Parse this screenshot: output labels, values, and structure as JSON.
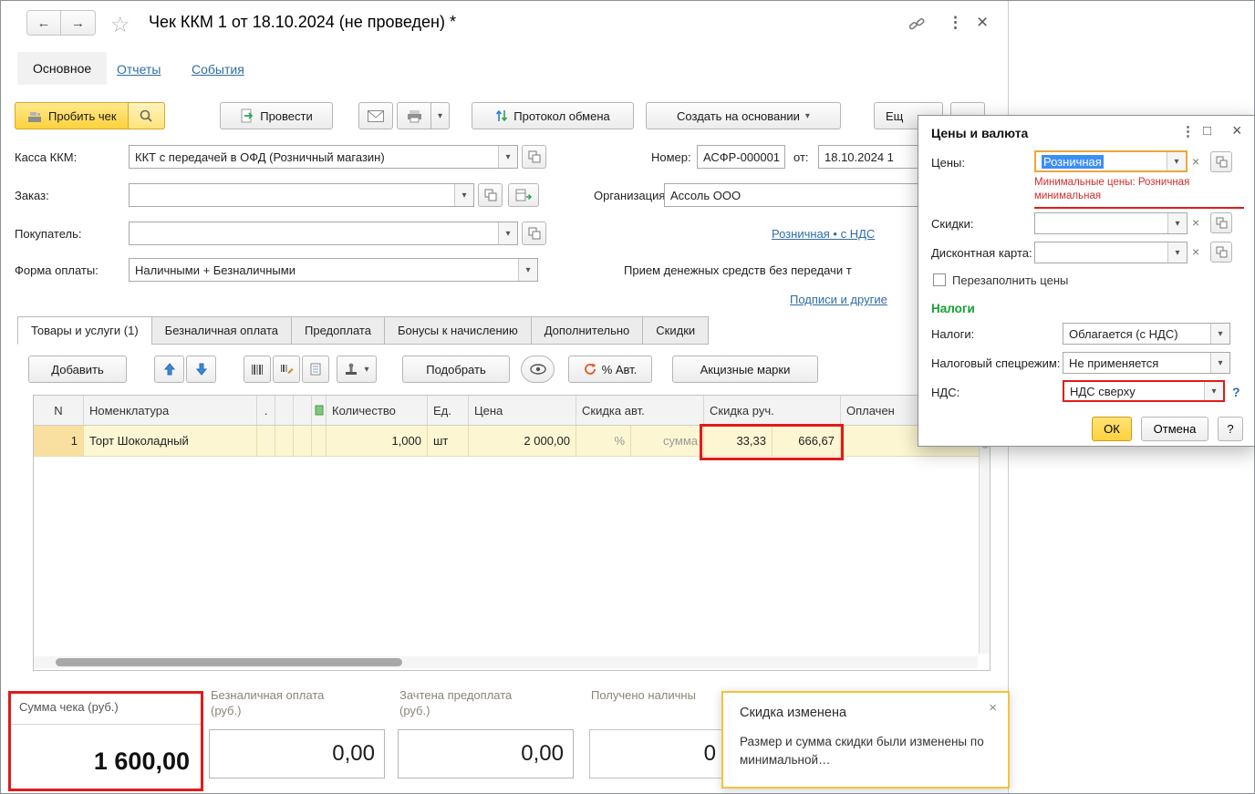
{
  "window": {
    "title": "Чек ККМ 1 от 18.10.2024 (не проведен) *",
    "nav": {
      "main": "Основное",
      "reports": "Отчеты",
      "events": "События"
    }
  },
  "icons": {
    "back": "←",
    "forward": "→",
    "star": "☆",
    "menu_dots": "⋮",
    "close": "×",
    "dropdown": "▾",
    "clear": "×",
    "maximize": "□",
    "question": "?"
  },
  "toolbar": {
    "punch_check": "Пробить чек",
    "post": "Провести",
    "protocol": "Протокол обмена",
    "create_based_on": "Создать на основании",
    "more": "Ещ"
  },
  "form": {
    "kassa": {
      "label": "Касса ККМ:",
      "value": "ККТ с передачей в ОФД (Розничный магазин)"
    },
    "order": {
      "label": "Заказ:",
      "value": ""
    },
    "customer": {
      "label": "Покупатель:",
      "value": ""
    },
    "payment": {
      "label": "Форма оплаты:",
      "value": "Наличными + Безналичными"
    },
    "number": {
      "label": "Номер:",
      "value": "АСФР-000001"
    },
    "date": {
      "label": "от:",
      "value": "18.10.2024 1"
    },
    "org": {
      "label": "Организация:",
      "value": "Ассоль ООО"
    },
    "price_type_link": "Розничная • с НДС",
    "note": "Прием денежных средств без передачи т",
    "signatures_link": "Подписи и другие"
  },
  "doc_tabs": [
    "Товары и услуги (1)",
    "Безналичная оплата",
    "Предоплата",
    "Бонусы к начислению",
    "Дополнительно",
    "Скидки"
  ],
  "table_toolbar": {
    "add": "Добавить",
    "pick": "Подобрать",
    "auto_discount": "% Авт.",
    "excise": "Акцизные марки"
  },
  "table": {
    "dot": ".",
    "headers": [
      "N",
      "Номенклатура",
      "Количество",
      "Ед.",
      "Цена",
      "Скидка авт.",
      "Скидка руч.",
      "Оплачен"
    ],
    "rows": [
      [
        "1",
        "Торт Шоколадный",
        "1,000",
        "шт",
        "2 000,00",
        "%",
        "сумма",
        "33,33",
        "666,67"
      ]
    ]
  },
  "totals": {
    "sum": {
      "label": "Сумма чека (руб.)",
      "value": "1 600,00"
    },
    "cashless": {
      "label": "Безналичная оплата",
      "label2": "(руб.)",
      "value": "0,00"
    },
    "prepaid": {
      "label": "Зачтена предоплата",
      "label2": "(руб.)",
      "value": "0,00"
    },
    "received": {
      "label": "Получено наличны",
      "value": "0"
    }
  },
  "toast": {
    "title": "Скидка изменена",
    "body": "Размер и сумма скидки были изменены по минимальной…"
  },
  "dialog": {
    "title": "Цены и валюта",
    "prices": {
      "label": "Цены:",
      "value": "Розничная"
    },
    "warning": "Минимальные цены: Розничная минимальная",
    "discounts_label": "Скидки:",
    "card_label": "Дисконтная карта:",
    "refill": "Перезаполнить цены",
    "taxes_section": "Налоги",
    "taxes": {
      "label": "Налоги:",
      "value": "Облагается (с НДС)"
    },
    "regime": {
      "label": "Налоговый спецрежим:",
      "value": "Не применяется"
    },
    "vat": {
      "label": "НДС:",
      "value": "НДС сверху"
    },
    "ok": "ОК",
    "cancel": "Отмена",
    "help": "?"
  }
}
